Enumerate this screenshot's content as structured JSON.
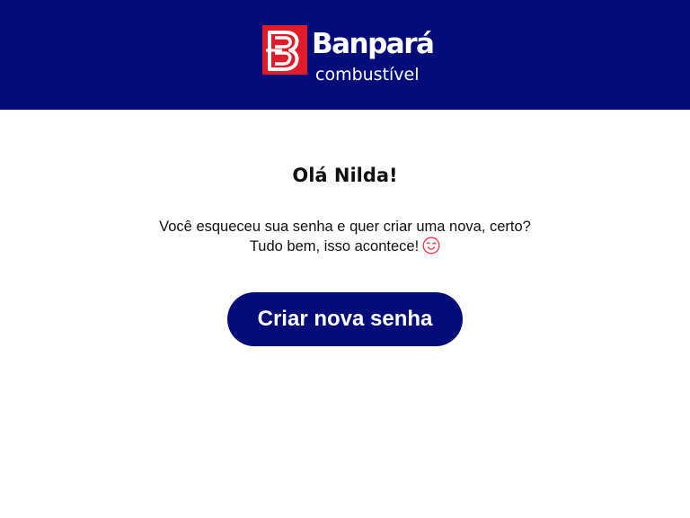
{
  "header": {
    "logo_brand": "Banpará",
    "logo_sub": "combustível",
    "background_color": "#030d7a",
    "logo_mark_color": "#e21b2b"
  },
  "main": {
    "greeting": "Olá Nilda!",
    "message_line1": "Você esqueceu sua senha e quer criar uma nova, certo?",
    "message_line2": "Tudo bem, isso acontece!",
    "message_icon": "winking-face-icon",
    "cta_label": "Criar nova senha",
    "cta_color": "#030d7a"
  }
}
